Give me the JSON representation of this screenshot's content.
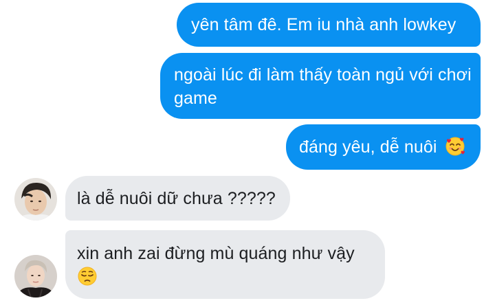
{
  "conversation": {
    "messages": [
      {
        "sender": "me",
        "text": "yên tâm đê. Em iu nhà anh lowkey"
      },
      {
        "sender": "me",
        "text": "ngoài lúc đi làm thấy toàn ngủ với chơi game"
      },
      {
        "sender": "me",
        "text": "đáng yêu, dễ nuôi",
        "emoji": "smiling-face-with-hearts-icon"
      },
      {
        "sender": "other",
        "text": "là dễ nuôi dữ chưa ?????"
      },
      {
        "sender": "other",
        "text": "xin anh zai đừng mù quáng như vậy",
        "emoji": "pensive-face-icon"
      }
    ]
  },
  "colors": {
    "outgoing_bubble": "#0a91f1",
    "incoming_bubble": "#e8eaed",
    "outgoing_text": "#ffffff",
    "incoming_text": "#1c1e21"
  }
}
